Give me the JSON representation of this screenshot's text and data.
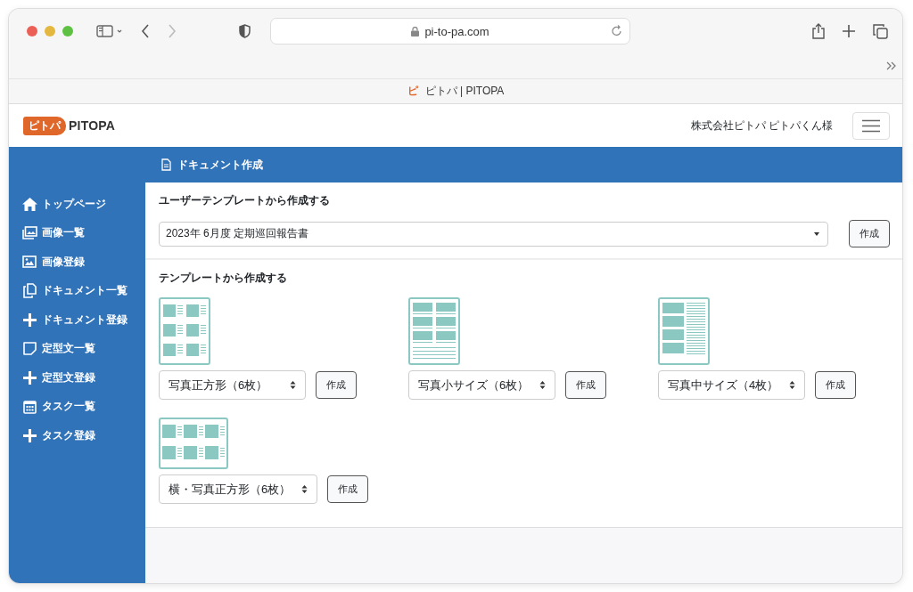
{
  "browser": {
    "url": "pi-to-pa.com",
    "tab": {
      "icon_text": "ピ",
      "title": "ピトパ | PITOPA"
    }
  },
  "header": {
    "logo_mark": "ピトパ",
    "logo_text": "PITOPA",
    "user": "株式会社ピトパ ピトパくん様"
  },
  "sidebar": {
    "items": [
      {
        "kind": "home",
        "label": "トップページ"
      },
      {
        "kind": "images",
        "label": "画像一覧"
      },
      {
        "kind": "image",
        "label": "画像登録"
      },
      {
        "kind": "copy",
        "label": "ドキュメント一覧"
      },
      {
        "kind": "plus",
        "label": "ドキュメント登録"
      },
      {
        "kind": "note",
        "label": "定型文一覧"
      },
      {
        "kind": "plus",
        "label": "定型文登録"
      },
      {
        "kind": "calendar",
        "label": "タスク一覧"
      },
      {
        "kind": "plus",
        "label": "タスク登録"
      }
    ]
  },
  "page_title": "ドキュメント作成",
  "user_template": {
    "heading": "ユーザーテンプレートから作成する",
    "value": "2023年 6月度 定期巡回報告書",
    "button": "作成"
  },
  "templates": {
    "heading": "テンプレートから作成する",
    "items": [
      {
        "kind": "square",
        "label": "写真正方形（6枚）",
        "button": "作成"
      },
      {
        "kind": "small",
        "label": "写真小サイズ（6枚）",
        "button": "作成"
      },
      {
        "kind": "medium",
        "label": "写真中サイズ（4枚）",
        "button": "作成"
      },
      {
        "kind": "landscape",
        "label": "横・写真正方形（6枚）",
        "button": "作成"
      }
    ]
  }
}
